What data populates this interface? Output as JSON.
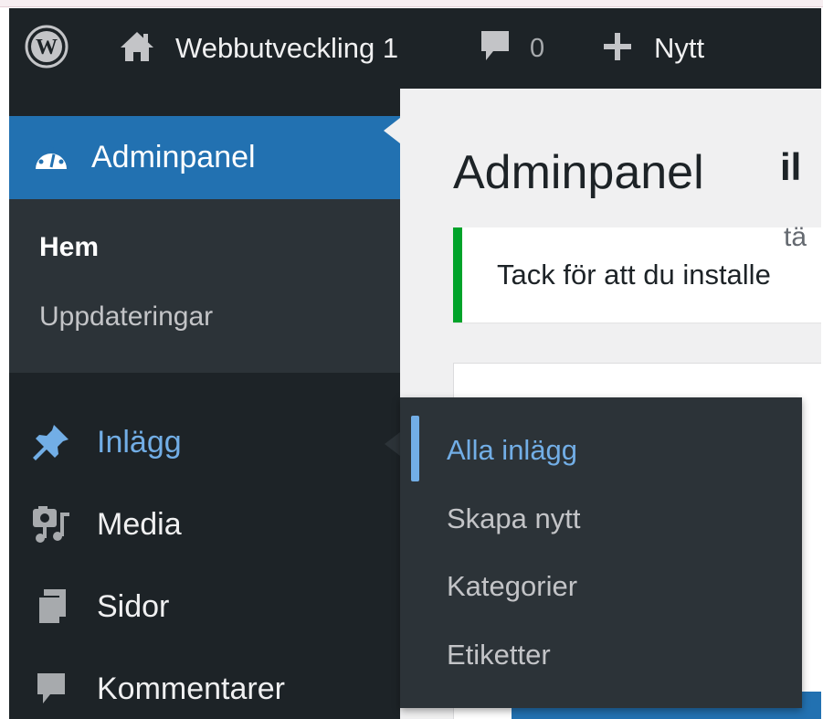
{
  "admin_bar": {
    "wp_logo_icon": "wordpress-logo-icon",
    "home_icon": "home-icon",
    "site_name": "Webbutveckling 1",
    "comment_icon": "comment-bubble-icon",
    "comment_count": "0",
    "new_icon": "plus-icon",
    "new_label": "Nytt"
  },
  "sidebar": {
    "current": {
      "icon": "dashboard-gauge-icon",
      "label": "Adminpanel"
    },
    "submenu": [
      {
        "label": "Hem",
        "active": true
      },
      {
        "label": "Uppdateringar",
        "active": false
      }
    ],
    "items": [
      {
        "icon": "pushpin-icon",
        "label": "Inlägg",
        "highlight": true
      },
      {
        "icon": "media-icon",
        "label": "Media"
      },
      {
        "icon": "pages-icon",
        "label": "Sidor"
      },
      {
        "icon": "comments-icon",
        "label": "Kommentarer"
      }
    ]
  },
  "flyout": {
    "items": [
      {
        "label": "Alla inlägg",
        "active": true
      },
      {
        "label": "Skapa nytt"
      },
      {
        "label": "Kategorier"
      },
      {
        "label": "Etiketter"
      }
    ]
  },
  "main": {
    "title": "Adminpanel",
    "notice_text": "Tack för att du installe",
    "panel_heading_fragment": "il",
    "panel_sub_fragment": "tä"
  },
  "colors": {
    "admin_bar_bg": "#1d2327",
    "menu_bg": "#1d2327",
    "submenu_bg": "#2c3338",
    "current_bg": "#2271b1",
    "link_highlight": "#72aee6",
    "notice_accent": "#00a32a",
    "content_bg": "#f0f0f1"
  }
}
